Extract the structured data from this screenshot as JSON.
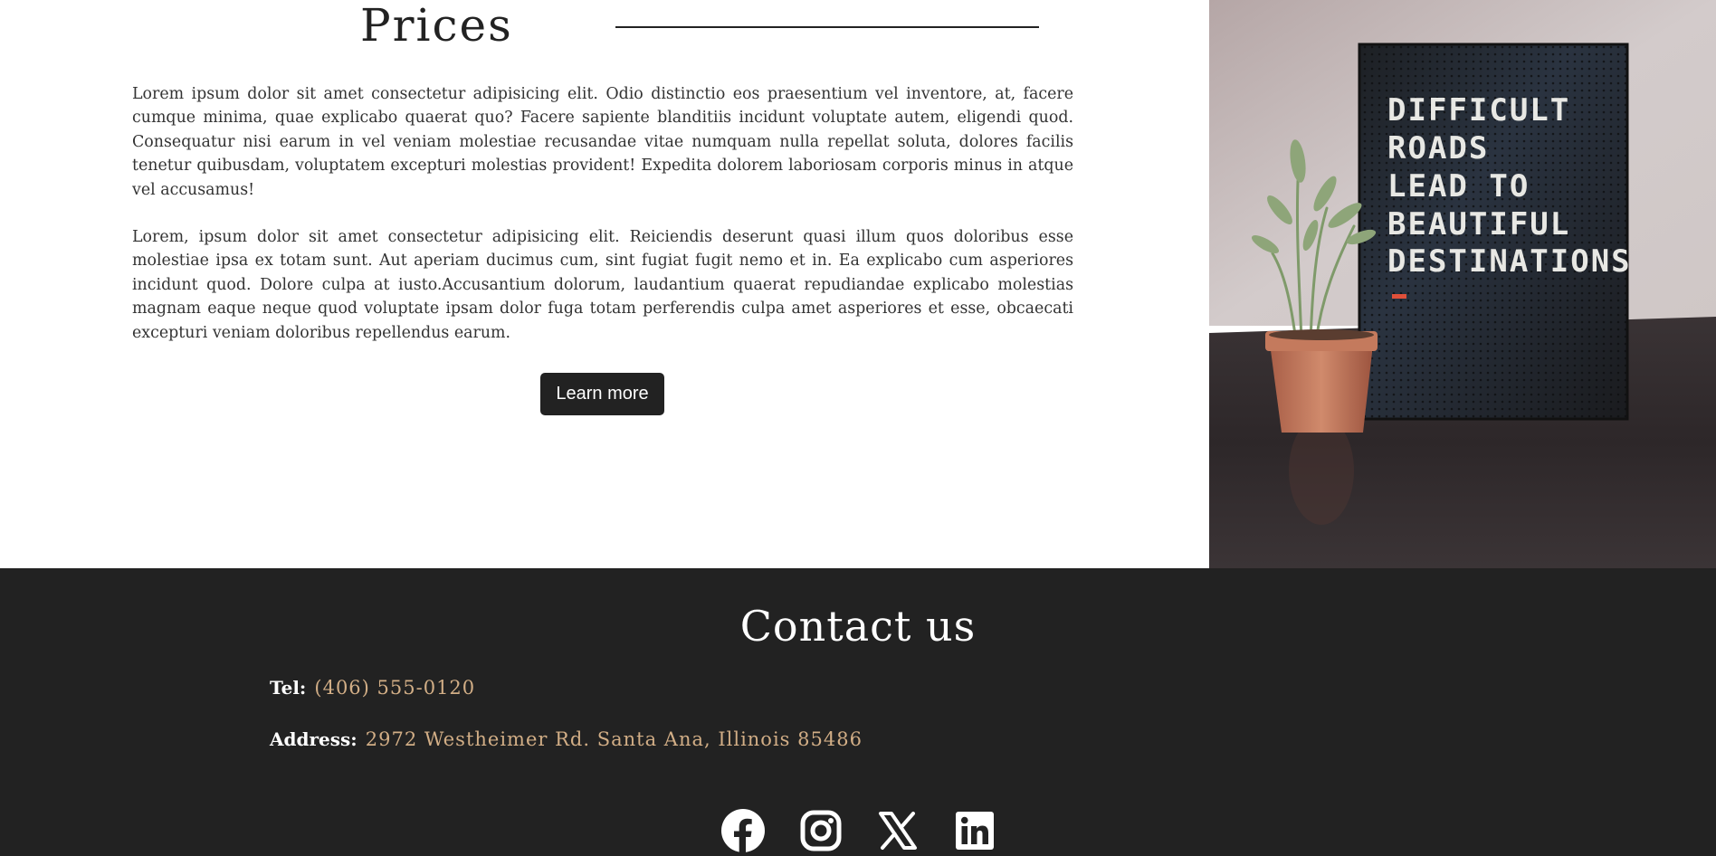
{
  "prices": {
    "title": "Prices",
    "paragraph1": "Lorem ipsum dolor sit amet consectetur adipisicing elit. Odio distinctio eos praesentium vel inventore, at, facere cumque minima, quae explicabo quaerat quo? Facere sapiente blanditiis incidunt voluptate autem, eligendi quod. Consequatur nisi earum in vel veniam molestiae recusandae vitae numquam nulla repellat soluta, dolores facilis tenetur quibusdam, voluptatem excepturi molestias provident! Expedita dolorem laboriosam corporis minus in atque vel accusamus!",
    "paragraph2": "Lorem, ipsum dolor sit amet consectetur adipisicing elit. Reiciendis deserunt quasi illum quos doloribus esse molestiae ipsa ex totam sunt. Aut aperiam ducimus cum, sint fugiat fugit nemo et in. Ea explicabo cum asperiores incidunt quod. Dolore culpa at iusto.Accusantium dolorum, laudantium quaerat repudiandae explicabo molestias magnam eaque neque quod voluptate ipsam dolor fuga totam perferendis culpa amet asperiores et esse, obcaecati excepturi veniam doloribus repellendus earum.",
    "button_label": "Learn more"
  },
  "photo": {
    "sign_lines": [
      "DIFFICULT",
      "ROADS",
      "LEAD TO",
      "BEAUTIFUL",
      "DESTINATIONS"
    ]
  },
  "contact": {
    "title": "Contact us",
    "tel_label": "Tel:",
    "tel_value": "(406) 555-0120",
    "address_label": "Address:",
    "address_value": "2972 Westheimer Rd. Santa Ana, Illinois 85486"
  },
  "social": {
    "icons": [
      "facebook-icon",
      "instagram-icon",
      "x-icon",
      "linkedin-icon"
    ]
  },
  "colors": {
    "dark": "#222222",
    "accent": "#d2ae86",
    "white": "#ffffff"
  }
}
